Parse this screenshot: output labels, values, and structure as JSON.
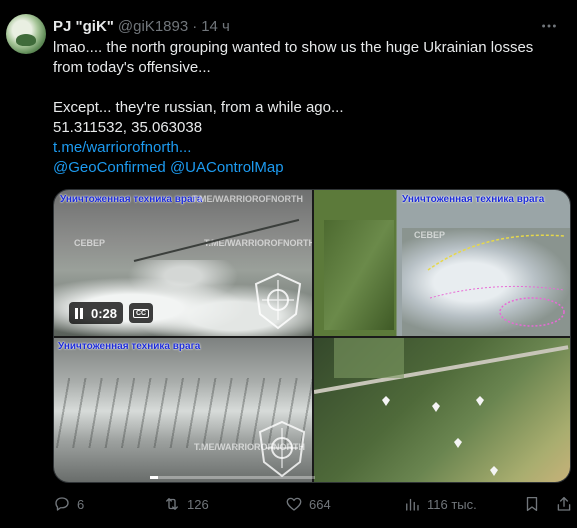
{
  "author": {
    "name": "PJ \"giK\"",
    "handle": "@giK1893",
    "separator": "·",
    "time": "14 ч"
  },
  "tweet": {
    "line1": "lmao.... the north grouping wanted to show us the huge Ukrainian losses",
    "line2": "from today's offensive...",
    "line3": "Except... they're russian, from a while ago...",
    "line4": "51.311532, 35.063038",
    "link": "t.me/warriorofnorth...",
    "mention1": "@GeoConfirmed",
    "mention2": "@UAControlMap"
  },
  "media": {
    "overlay_title_1": "Уничтоженная техника врага",
    "overlay_title_2": "Уничтоженная техника врага",
    "overlay_title_3": "Уничтоженная техника врага",
    "watermark": "T.ME/WARRIOROFNORTH",
    "watermark_prefix": "СЕВЕР",
    "video_time": "0:28",
    "progress": 0.05,
    "icons": [
      "pause-icon",
      "closed-captions-icon"
    ]
  },
  "actions": {
    "replies": "6",
    "retweets": "126",
    "likes": "664",
    "views": "116 тыс.",
    "icons": [
      "reply-icon",
      "retweet-icon",
      "like-icon",
      "views-icon",
      "bookmark-icon",
      "share-icon"
    ]
  },
  "colors": {
    "background": "#000000",
    "text": "#e7e9ea",
    "secondary": "#71767b",
    "link": "#1d9bf0",
    "overlay_title": "#1c2bd8"
  }
}
